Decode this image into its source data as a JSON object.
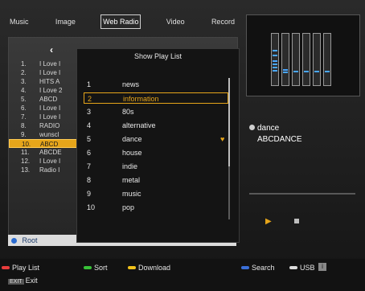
{
  "tabs": [
    "Music",
    "Image",
    "Web Radio",
    "Video",
    "Record"
  ],
  "active_tab_index": 2,
  "list": {
    "items": [
      {
        "num": "1.",
        "name": "I Love I"
      },
      {
        "num": "2.",
        "name": "I Love I"
      },
      {
        "num": "3.",
        "name": "HITS A"
      },
      {
        "num": "4.",
        "name": "I Love 2"
      },
      {
        "num": "5.",
        "name": "ABCD"
      },
      {
        "num": "6.",
        "name": "I Love I"
      },
      {
        "num": "7.",
        "name": "I Love I"
      },
      {
        "num": "8.",
        "name": "RADIO"
      },
      {
        "num": "9.",
        "name": "wunscl"
      },
      {
        "num": "10.",
        "name": "ABCD"
      },
      {
        "num": "11.",
        "name": "ABCDE"
      },
      {
        "num": "12.",
        "name": "I Love I"
      },
      {
        "num": "13.",
        "name": "Radio I"
      }
    ],
    "selected_index": 9
  },
  "root_label": "Root",
  "playlist_popup": {
    "title": "Show Play List",
    "items": [
      {
        "num": "1",
        "label": "news"
      },
      {
        "num": "2",
        "label": "information"
      },
      {
        "num": "3",
        "label": "80s"
      },
      {
        "num": "4",
        "label": "alternative"
      },
      {
        "num": "5",
        "label": "dance",
        "favorite": true
      },
      {
        "num": "6",
        "label": "house"
      },
      {
        "num": "7",
        "label": "indie"
      },
      {
        "num": "8",
        "label": "metal"
      },
      {
        "num": "9",
        "label": "music"
      },
      {
        "num": "10",
        "label": "pop"
      }
    ],
    "selected_index": 1
  },
  "now_playing": {
    "genre": "dance",
    "station": "ABCDANCE"
  },
  "legend": [
    {
      "label": "Play List",
      "color": "#e83c3c"
    },
    {
      "label": "Sort",
      "color": "#38c238"
    },
    {
      "label": "Download",
      "color": "#f2c21b"
    },
    {
      "label": "Search",
      "color": "#3a6fd8"
    },
    {
      "label": "USB",
      "color": "#dcdcdc"
    }
  ],
  "exit": {
    "key": "EXIT",
    "label": "Exit"
  },
  "colors": {
    "accent": "#e6a51a",
    "equalizer": "#4aa7ff"
  }
}
